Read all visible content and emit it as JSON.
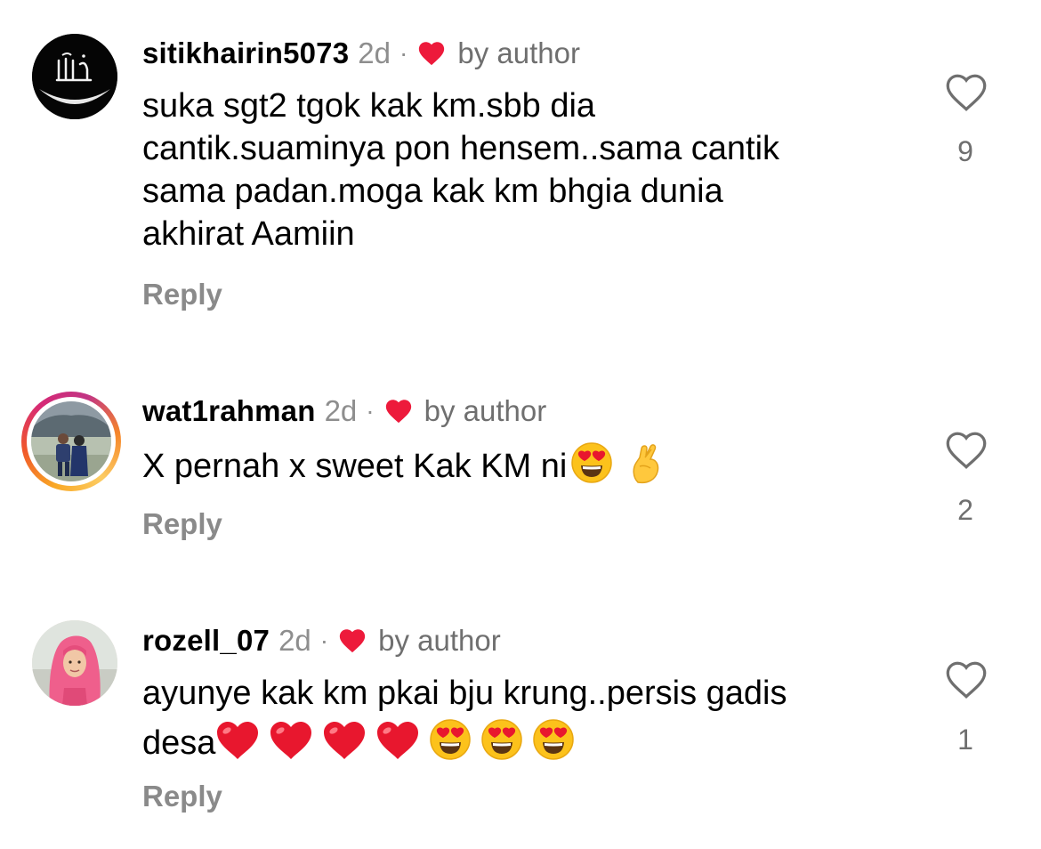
{
  "comments": [
    {
      "username": "sitikhairin5073",
      "time": "2d",
      "separator": "·",
      "liked_by": "by author",
      "text": "suka sgt2 tgok kak km.sbb dia cantik.suaminya pon hensem..sama cantik sama padan.moga kak km bhgia dunia akhirat Aamiin",
      "reply": "Reply",
      "likes": "9",
      "avatar": "calligraphy-black-avatar",
      "text_lines": [
        "suka sgt2 tgok kak km.sbb dia",
        "cantik.suaminya pon hensem..sama cantik",
        "sama padan.moga kak km bhgia dunia",
        "akhirat Aamiin"
      ]
    },
    {
      "username": "wat1rahman",
      "time": "2d",
      "separator": "·",
      "liked_by": "by author",
      "text": "X pernah x sweet Kak KM ni",
      "emojis": [
        "heart-eyes-emoji",
        "crossed-fingers-emoji"
      ],
      "reply": "Reply",
      "likes": "2",
      "avatar": "couple-photo-avatar-with-story-ring"
    },
    {
      "username": "rozell_07",
      "time": "2d",
      "separator": "·",
      "liked_by": "by author",
      "text_line1": "ayunye kak km pkai bju krung..persis gadis",
      "text_line2": "desa",
      "emojis": [
        "red-heart-emoji",
        "red-heart-emoji",
        "red-heart-emoji",
        "red-heart-emoji",
        "heart-eyes-emoji",
        "heart-eyes-emoji",
        "heart-eyes-emoji"
      ],
      "reply": "Reply",
      "likes": "1",
      "avatar": "woman-pink-hijab-avatar"
    }
  ],
  "colors": {
    "heart_red": "#ed1a3b",
    "muted_text": "#8e8e8e",
    "reply_text": "#8a8a8a"
  }
}
